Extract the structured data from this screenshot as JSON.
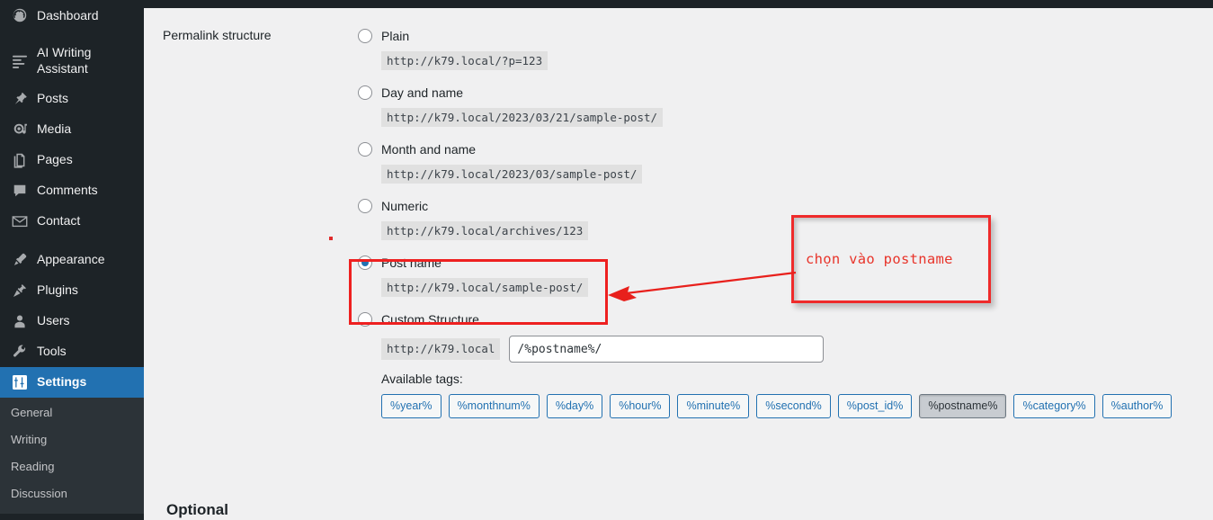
{
  "sidebar": {
    "items": [
      {
        "label": "Dashboard",
        "icon": "dashboard-icon",
        "name": "sidebar-item-dashboard",
        "current": false,
        "gap_after": true
      },
      {
        "label": "AI Writing Assistant",
        "icon": "list-lines-icon",
        "name": "sidebar-item-ai-writing-assistant",
        "current": false,
        "gap_after": false
      },
      {
        "label": "Posts",
        "icon": "pin-icon",
        "name": "sidebar-item-posts",
        "current": false,
        "gap_after": false
      },
      {
        "label": "Media",
        "icon": "media-icon",
        "name": "sidebar-item-media",
        "current": false,
        "gap_after": false
      },
      {
        "label": "Pages",
        "icon": "pages-icon",
        "name": "sidebar-item-pages",
        "current": false,
        "gap_after": false
      },
      {
        "label": "Comments",
        "icon": "comment-icon",
        "name": "sidebar-item-comments",
        "current": false,
        "gap_after": false
      },
      {
        "label": "Contact",
        "icon": "envelope-icon",
        "name": "sidebar-item-contact",
        "current": false,
        "gap_after": true
      },
      {
        "label": "Appearance",
        "icon": "brush-icon",
        "name": "sidebar-item-appearance",
        "current": false,
        "gap_after": false
      },
      {
        "label": "Plugins",
        "icon": "plug-icon",
        "name": "sidebar-item-plugins",
        "current": false,
        "gap_after": false
      },
      {
        "label": "Users",
        "icon": "user-icon",
        "name": "sidebar-item-users",
        "current": false,
        "gap_after": false
      },
      {
        "label": "Tools",
        "icon": "wrench-icon",
        "name": "sidebar-item-tools",
        "current": false,
        "gap_after": false
      },
      {
        "label": "Settings",
        "icon": "sliders-icon",
        "name": "sidebar-item-settings",
        "current": true,
        "gap_after": false
      }
    ],
    "submenu": [
      {
        "label": "General",
        "name": "submenu-item-general"
      },
      {
        "label": "Writing",
        "name": "submenu-item-writing"
      },
      {
        "label": "Reading",
        "name": "submenu-item-reading"
      },
      {
        "label": "Discussion",
        "name": "submenu-item-discussion"
      }
    ],
    "active_color": "#2271b1",
    "background": "#1d2327",
    "submenu_background": "#2c3338"
  },
  "main": {
    "row_label": "Permalink structure",
    "optional_heading": "Optional",
    "permalink_options": [
      {
        "label": "Plain",
        "example": "http://k79.local/?p=123",
        "selected": false,
        "name": "permalink-option-plain"
      },
      {
        "label": "Day and name",
        "example": "http://k79.local/2023/03/21/sample-post/",
        "selected": false,
        "name": "permalink-option-day-and-name"
      },
      {
        "label": "Month and name",
        "example": "http://k79.local/2023/03/sample-post/",
        "selected": false,
        "name": "permalink-option-month-and-name"
      },
      {
        "label": "Numeric",
        "example": "http://k79.local/archives/123",
        "selected": false,
        "name": "permalink-option-numeric"
      },
      {
        "label": "Post name",
        "example": "http://k79.local/sample-post/",
        "selected": true,
        "name": "permalink-option-post-name"
      }
    ],
    "custom_structure": {
      "label": "Custom Structure",
      "selected": false,
      "prefix": "http://k79.local",
      "value": "/%postname%/",
      "placeholder": ""
    },
    "available_tags_label": "Available tags:",
    "available_tags": [
      {
        "label": "%year%",
        "active": false
      },
      {
        "label": "%monthnum%",
        "active": false
      },
      {
        "label": "%day%",
        "active": false
      },
      {
        "label": "%hour%",
        "active": false
      },
      {
        "label": "%minute%",
        "active": false
      },
      {
        "label": "%second%",
        "active": false
      },
      {
        "label": "%post_id%",
        "active": false
      },
      {
        "label": "%postname%",
        "active": true
      },
      {
        "label": "%category%",
        "active": false
      },
      {
        "label": "%author%",
        "active": false
      }
    ]
  },
  "annotations": {
    "note_text": "chọn vào postname",
    "highlight_color": "#ee2020",
    "note_border_color": "#ef2b2b",
    "note_text_color": "#e8342a"
  }
}
